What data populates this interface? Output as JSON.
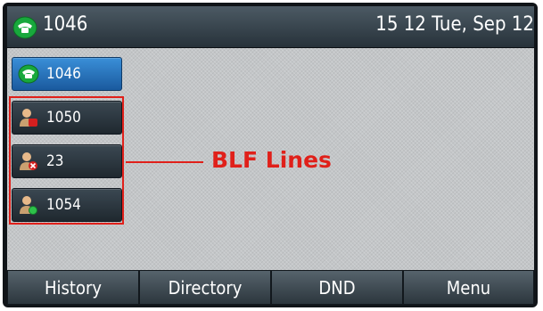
{
  "status_bar": {
    "extension": "1046",
    "datetime": "15 12 Tue, Sep 12",
    "icon": "phone-handset-icon"
  },
  "line_keys": [
    {
      "label": "1046",
      "icon": "phone-handset-icon",
      "state": "active"
    },
    {
      "label": "1050",
      "icon": "user-busy-icon",
      "state": "blf"
    },
    {
      "label": "23",
      "icon": "user-unavailable-icon",
      "state": "blf"
    },
    {
      "label": "1054",
      "icon": "user-idle-icon",
      "state": "blf"
    }
  ],
  "annotation": {
    "label": "BLF Lines",
    "color": "#e0201a"
  },
  "softkeys": [
    {
      "label": "History"
    },
    {
      "label": "Directory"
    },
    {
      "label": "DND"
    },
    {
      "label": "Menu"
    }
  ],
  "colors": {
    "accent_blue": "#2f7fc8",
    "status_green": "#2ec24a",
    "busy_red": "#e02a2a"
  }
}
